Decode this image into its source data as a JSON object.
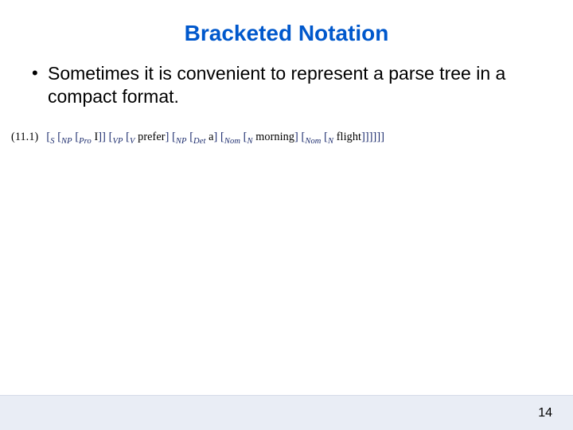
{
  "title": "Bracketed Notation",
  "bullet": {
    "dot": "•",
    "text": "Sometimes it is convenient to represent a parse tree in a compact format."
  },
  "notation": {
    "eqnum": "(11.1)",
    "tokens": [
      {
        "t": "br",
        "v": "["
      },
      {
        "t": "sub",
        "v": "S"
      },
      {
        "t": "sp"
      },
      {
        "t": "br",
        "v": "["
      },
      {
        "t": "sub",
        "v": "NP"
      },
      {
        "t": "sp"
      },
      {
        "t": "br",
        "v": "["
      },
      {
        "t": "sub",
        "v": "Pro"
      },
      {
        "t": "sp"
      },
      {
        "t": "w",
        "v": "I"
      },
      {
        "t": "br",
        "v": "]]"
      },
      {
        "t": "sp"
      },
      {
        "t": "br",
        "v": "["
      },
      {
        "t": "sub",
        "v": "VP"
      },
      {
        "t": "sp"
      },
      {
        "t": "br",
        "v": "["
      },
      {
        "t": "sub",
        "v": "V"
      },
      {
        "t": "sp"
      },
      {
        "t": "w",
        "v": "prefer"
      },
      {
        "t": "br",
        "v": "]"
      },
      {
        "t": "sp"
      },
      {
        "t": "br",
        "v": "["
      },
      {
        "t": "sub",
        "v": "NP"
      },
      {
        "t": "sp"
      },
      {
        "t": "br",
        "v": "["
      },
      {
        "t": "sub",
        "v": "Det"
      },
      {
        "t": "sp"
      },
      {
        "t": "w",
        "v": "a"
      },
      {
        "t": "br",
        "v": "]"
      },
      {
        "t": "sp"
      },
      {
        "t": "br",
        "v": "["
      },
      {
        "t": "sub",
        "v": "Nom"
      },
      {
        "t": "sp"
      },
      {
        "t": "br",
        "v": "["
      },
      {
        "t": "sub",
        "v": "N"
      },
      {
        "t": "sp"
      },
      {
        "t": "w",
        "v": "morning"
      },
      {
        "t": "br",
        "v": "]"
      },
      {
        "t": "sp"
      },
      {
        "t": "br",
        "v": "["
      },
      {
        "t": "sub",
        "v": "Nom"
      },
      {
        "t": "sp"
      },
      {
        "t": "br",
        "v": "["
      },
      {
        "t": "sub",
        "v": "N"
      },
      {
        "t": "sp"
      },
      {
        "t": "w",
        "v": "flight"
      },
      {
        "t": "br",
        "v": "]]]]]]"
      }
    ]
  },
  "page_number": "14"
}
